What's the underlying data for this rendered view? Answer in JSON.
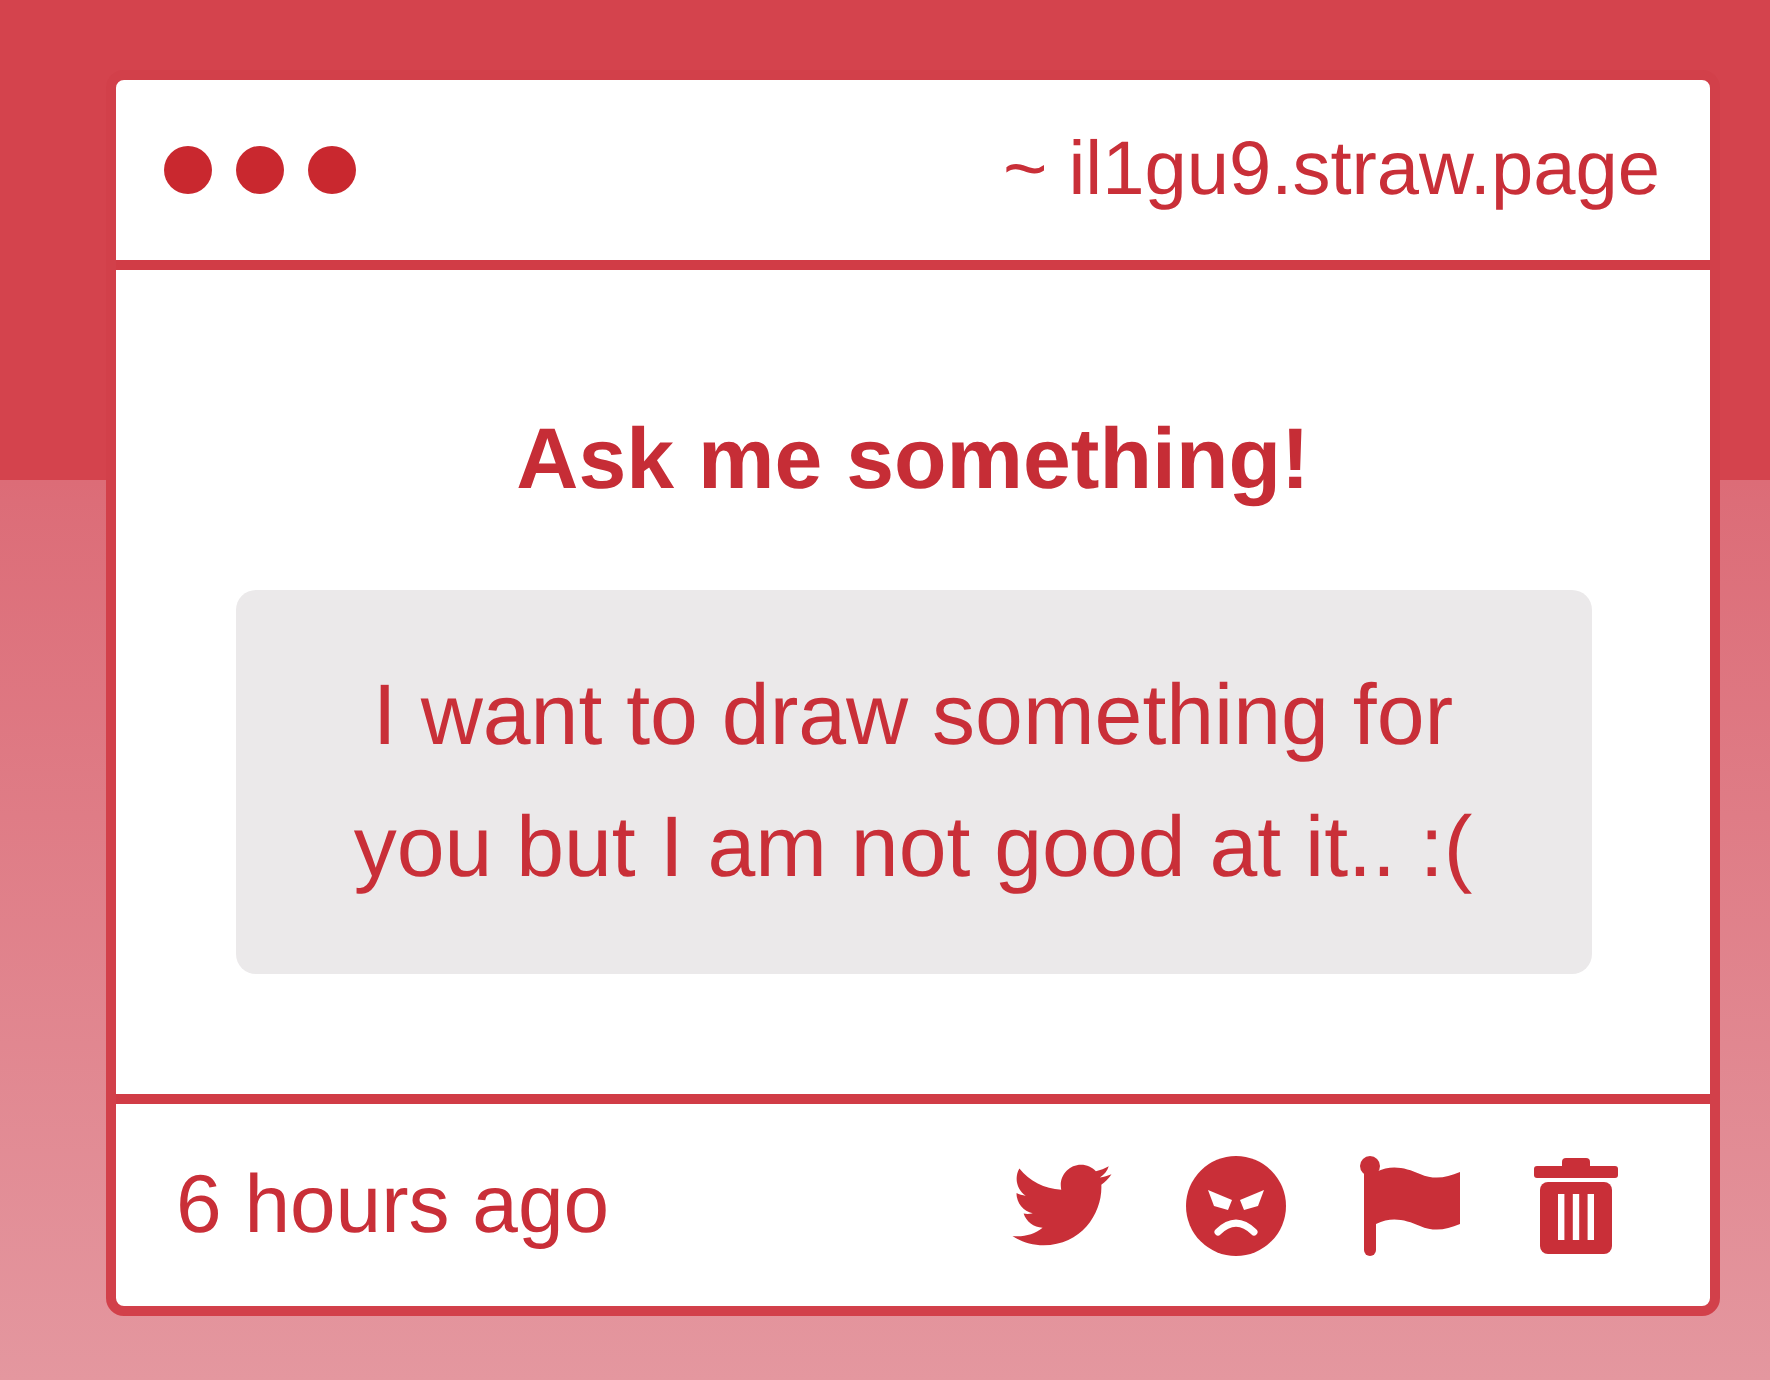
{
  "window": {
    "url": "~ il1gu9.straw.page"
  },
  "card": {
    "title": "Ask me something!",
    "question": "I want to draw something for you but I am not good at it.. :(",
    "time": "6 hours ago",
    "actions": [
      {
        "kind": "bird"
      },
      {
        "kind": "angry-face"
      },
      {
        "kind": "flag"
      },
      {
        "kind": "trash"
      }
    ]
  }
}
